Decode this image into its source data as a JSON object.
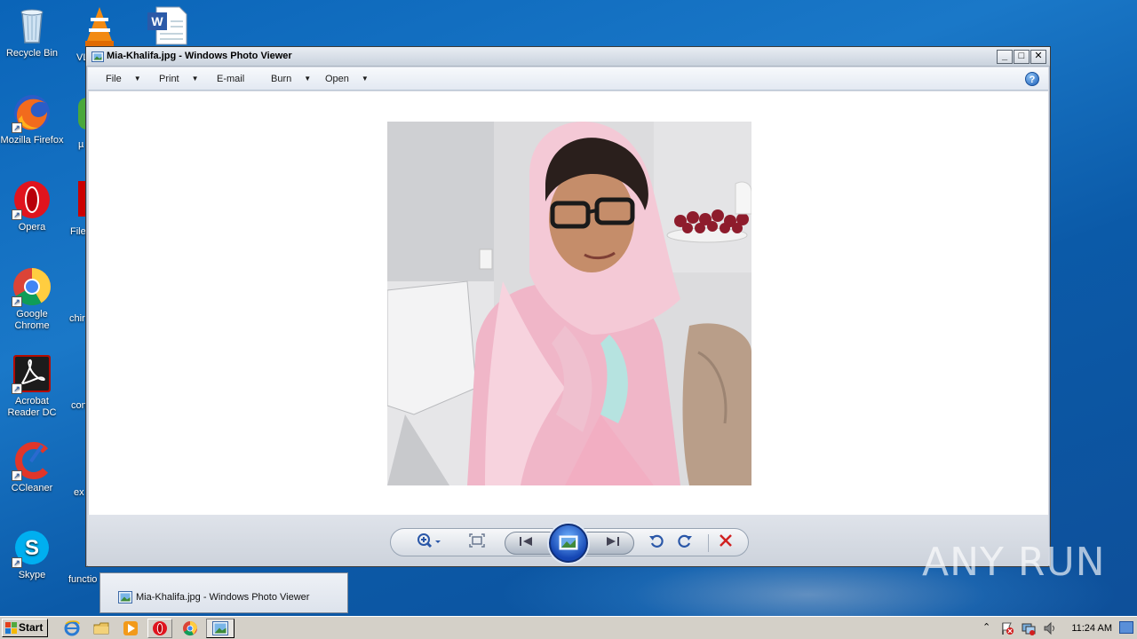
{
  "desktop": {
    "icons": [
      {
        "label": "Recycle Bin",
        "icon": "recycle-bin-icon"
      },
      {
        "label": "Mozilla Firefox",
        "icon": "firefox-icon"
      },
      {
        "label": "Opera",
        "icon": "opera-icon"
      },
      {
        "label": "Google Chrome",
        "icon": "chrome-icon"
      },
      {
        "label": "Acrobat Reader DC",
        "icon": "acrobat-icon"
      },
      {
        "label": "CCleaner",
        "icon": "ccleaner-icon"
      },
      {
        "label": "Skype",
        "icon": "skype-icon"
      }
    ],
    "second_column": [
      "VL",
      "µ",
      "File",
      "chir",
      "con",
      "ex",
      "functio"
    ]
  },
  "window": {
    "title": "Mia-Khalifa.jpg - Windows Photo Viewer",
    "menu": {
      "file": "File",
      "print": "Print",
      "email": "E-mail",
      "burn": "Burn",
      "open": "Open"
    },
    "help_label": "?",
    "photo_alt": "Mia-Khalifa.jpg"
  },
  "controls": {
    "zoom": "zoom-icon",
    "fit": "actual-size-icon",
    "previous": "previous-icon",
    "slideshow": "slideshow-icon",
    "next": "next-icon",
    "rotate_ccw": "rotate-counterclockwise-icon",
    "rotate_cw": "rotate-clockwise-icon",
    "delete": "delete-icon"
  },
  "taskbar": {
    "start_label": "Start",
    "preview_title": "Mia-Khalifa.jpg - Windows Photo Viewer",
    "clock": "11:24 AM"
  },
  "watermark": "ANY RUN",
  "colors": {
    "desktop_blue": "#1a78c8",
    "delete_red": "#d02020",
    "control_blue": "#2a57a8"
  }
}
